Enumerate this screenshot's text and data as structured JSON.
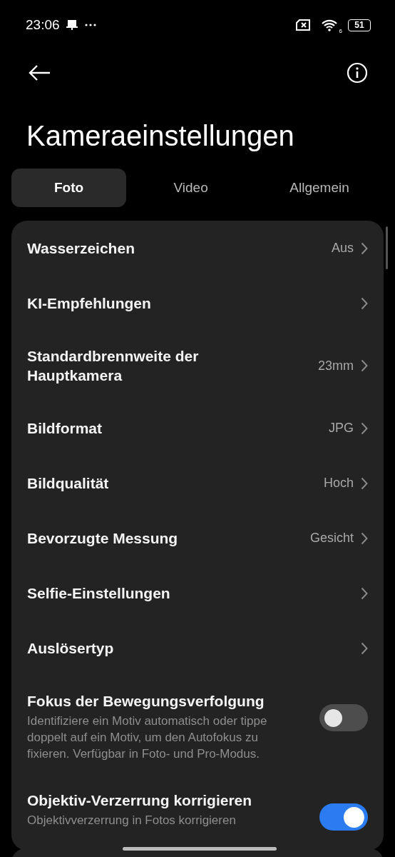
{
  "status_bar": {
    "time": "23:06",
    "wifi_label": "6",
    "battery": "51"
  },
  "title": "Kameraeinstellungen",
  "tabs": [
    {
      "label": "Foto",
      "selected": true
    },
    {
      "label": "Video",
      "selected": false
    },
    {
      "label": "Allgemein",
      "selected": false
    }
  ],
  "settings": [
    {
      "kind": "nav",
      "title": "Wasserzeichen",
      "value": "Aus"
    },
    {
      "kind": "nav",
      "title": "KI-Empfehlungen"
    },
    {
      "kind": "nav",
      "title": "Standardbrennweite der Hauptkamera",
      "value": "23mm"
    },
    {
      "kind": "nav",
      "title": "Bildformat",
      "value": "JPG"
    },
    {
      "kind": "nav",
      "title": "Bildqualität",
      "value": "Hoch"
    },
    {
      "kind": "nav",
      "title": "Bevorzugte Messung",
      "value": "Gesicht"
    },
    {
      "kind": "nav",
      "title": "Selfie-Einstellungen"
    },
    {
      "kind": "nav",
      "title": "Auslösertyp"
    },
    {
      "kind": "toggle",
      "title": "Fokus der Bewegungsverfolgung",
      "description": "Identifiziere ein Motiv automatisch oder tippe doppelt auf ein Motiv, um den Autofokus zu fixieren. Verfügbar in Foto- und Pro-Modus.",
      "on": false
    },
    {
      "kind": "toggle",
      "title": "Objektiv-Verzerrung korrigieren",
      "description": "Objektivverzerrung in Fotos korrigieren",
      "on": true
    }
  ]
}
